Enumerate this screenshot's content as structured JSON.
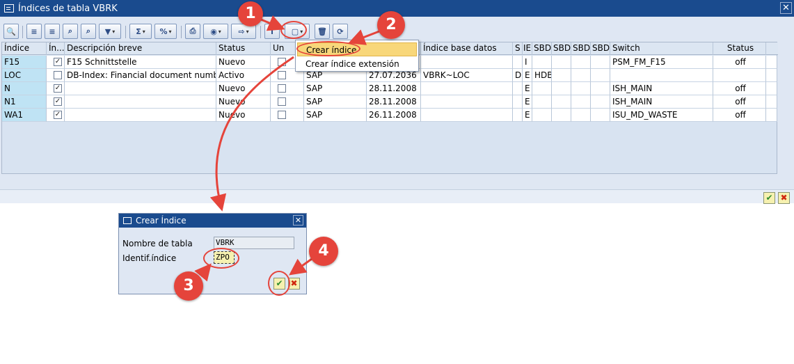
{
  "window": {
    "title": "Índices de tabla VBRK"
  },
  "columns": [
    "Índice",
    "Ín...",
    "Descripción breve",
    "Status",
    "Un",
    "",
    "",
    "Índice base datos",
    "S",
    "IE",
    "SBD",
    "SBD",
    "SBD",
    "SBD",
    "Switch",
    "Status"
  ],
  "rows": [
    {
      "indice": "F15",
      "in": true,
      "desc": "F15 Schnittstelle",
      "status": "Nuevo",
      "un": false,
      "src": "",
      "date": "",
      "dbindex": "",
      "s": "",
      "ie": "I",
      "sbd1": "",
      "switch": "PSM_FM_F15",
      "status2": "off"
    },
    {
      "indice": "LOC",
      "in": false,
      "desc": "DB-Index: Financial document number",
      "status": "Activo",
      "un": false,
      "src": "SAP",
      "date": "27.07.2036",
      "dbindex": "VBRK~LOC",
      "s": "D",
      "ie": "E",
      "sbd1": "HDB",
      "switch": "",
      "status2": ""
    },
    {
      "indice": "N",
      "in": true,
      "desc": "",
      "status": "Nuevo",
      "un": false,
      "src": "SAP",
      "date": "28.11.2008",
      "dbindex": "",
      "s": "",
      "ie": "E",
      "sbd1": "",
      "switch": "ISH_MAIN",
      "status2": "off"
    },
    {
      "indice": "N1",
      "in": true,
      "desc": "",
      "status": "Nuevo",
      "un": false,
      "src": "SAP",
      "date": "28.11.2008",
      "dbindex": "",
      "s": "",
      "ie": "E",
      "sbd1": "",
      "switch": "ISH_MAIN",
      "status2": "off"
    },
    {
      "indice": "WA1",
      "in": true,
      "desc": "",
      "status": "Nuevo",
      "un": false,
      "src": "SAP",
      "date": "26.11.2008",
      "dbindex": "",
      "s": "",
      "ie": "E",
      "sbd1": "",
      "switch": "ISU_MD_WASTE",
      "status2": "off"
    }
  ],
  "menu": {
    "item1": "Crear índice",
    "item2": "Crear índice extensión"
  },
  "dialog": {
    "title": "Crear Índice",
    "label_table": "Nombre de tabla",
    "value_table": "VBRK",
    "label_index": "Identif.índice",
    "value_index": "ZPO"
  },
  "callouts": [
    "1",
    "2",
    "3",
    "4"
  ],
  "colors": {
    "titlebar": "#1a4b8e",
    "callout": "#e5443b",
    "highlight": "#f8d77a"
  }
}
